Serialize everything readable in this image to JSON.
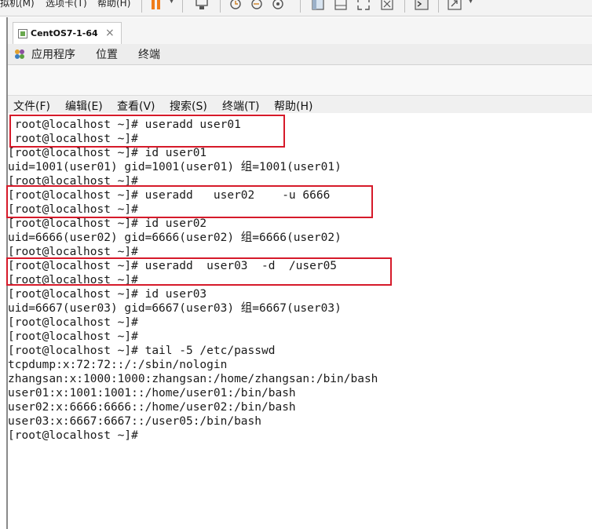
{
  "vm_menu": {
    "vm_item": "拟机(M)",
    "tabs_item": "选项卡(T)",
    "help_item": "帮助(H)"
  },
  "tab": {
    "title": "CentOS7-1-64",
    "close": "×"
  },
  "gnome": {
    "applications": "应用程序",
    "places": "位置",
    "terminal": "终端"
  },
  "terminal_menu": [
    "文件(F)",
    "编辑(E)",
    "查看(V)",
    "搜索(S)",
    "终端(T)",
    "帮助(H)"
  ],
  "terminal_lines": [
    " root@localhost ~]# useradd user01",
    " root@localhost ~]#",
    "[root@localhost ~]# id user01",
    "uid=1001(user01) gid=1001(user01) 组=1001(user01)",
    "[root@localhost ~]#",
    "[root@localhost ~]# useradd   user02    -u 6666",
    "[root@localhost ~]#",
    "[root@localhost ~]# id user02",
    "uid=6666(user02) gid=6666(user02) 组=6666(user02)",
    "[root@localhost ~]#",
    "[root@localhost ~]# useradd  user03  -d  /user05",
    "[root@localhost ~]#",
    "[root@localhost ~]# id user03",
    "uid=6667(user03) gid=6667(user03) 组=6667(user03)",
    "[root@localhost ~]#",
    "[root@localhost ~]#",
    "[root@localhost ~]# tail -5 /etc/passwd",
    "tcpdump:x:72:72::/:/sbin/nologin",
    "zhangsan:x:1000:1000:zhangsan:/home/zhangsan:/bin/bash",
    "user01:x:1001:1001::/home/user01:/bin/bash",
    "user02:x:6666:6666::/home/user02:/bin/bash",
    "user03:x:6667:6667::/user05:/bin/bash",
    "[root@localhost ~]#"
  ],
  "colors": {
    "highlight": "#d61a2a",
    "pause_orange": "#f07d1a"
  }
}
